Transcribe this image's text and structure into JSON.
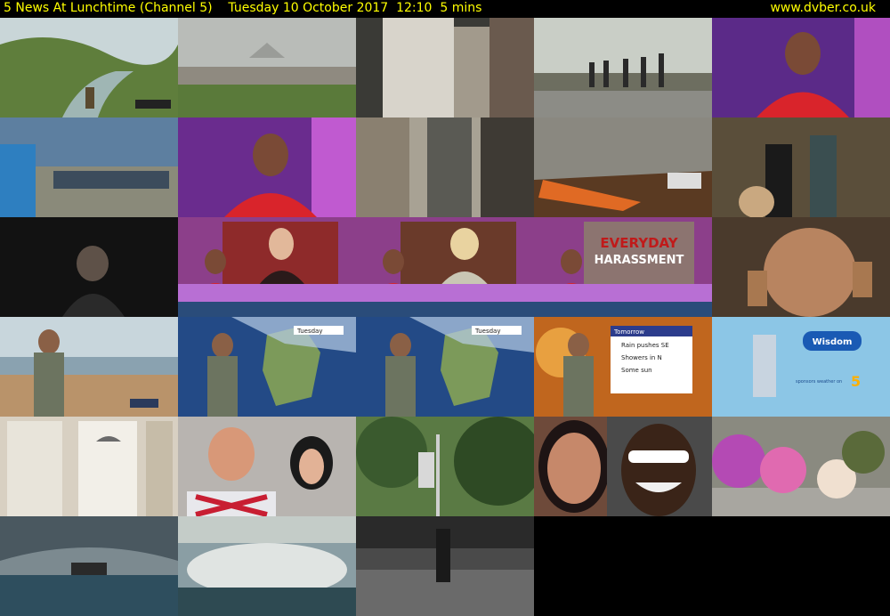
{
  "header": {
    "title": "5 News At Lunchtime (Channel 5)    Tuesday 10 October 2017  12:10  5 mins",
    "site": "www.dvber.co.uk"
  },
  "colors": {
    "header_text": "#ffff00",
    "background": "#000000"
  },
  "thumbnails": [
    {
      "id": 1,
      "bg": "#6f8a4c",
      "text": []
    },
    {
      "id": 2,
      "bg": "#8a8f86",
      "text": []
    },
    {
      "id": 3,
      "bg": "#b9b4ab",
      "text": []
    },
    {
      "id": 4,
      "bg": "#9aa28e",
      "text": []
    },
    {
      "id": 5,
      "bg": "#6a2c8e",
      "text": []
    },
    {
      "id": 6,
      "bg": "#4e6c86",
      "text": []
    },
    {
      "id": 7,
      "bg": "#7b2d9b",
      "text": []
    },
    {
      "id": 8,
      "bg": "#8c8577",
      "text": []
    },
    {
      "id": 9,
      "bg": "#7f7a72",
      "text": []
    },
    {
      "id": 10,
      "bg": "#50493a",
      "text": []
    },
    {
      "id": 11,
      "bg": "#151515",
      "text": []
    },
    {
      "id": 12,
      "bg": "#8c3f8a",
      "text": []
    },
    {
      "id": 13,
      "bg": "#8c3f8a",
      "text": []
    },
    {
      "id": 14,
      "bg": "#8c3f8a",
      "text": [
        "EVERYDAY",
        "HARASSMENT"
      ]
    },
    {
      "id": 15,
      "bg": "#6c4a36",
      "text": []
    },
    {
      "id": 16,
      "bg": "#b49876",
      "text": []
    },
    {
      "id": 17,
      "bg": "#234a86",
      "text": [
        "Tuesday"
      ]
    },
    {
      "id": 18,
      "bg": "#234a86",
      "text": [
        "Tuesday"
      ]
    },
    {
      "id": 19,
      "bg": "#c0661e",
      "text": [
        "Tomorrow",
        "Rain pushes SE",
        "Showers in N",
        "Some sun"
      ]
    },
    {
      "id": 20,
      "bg": "#8cc6e6",
      "text": [
        "Wisdom",
        "sponsors weather on",
        "5"
      ]
    },
    {
      "id": 21,
      "bg": "#cfc6b8",
      "text": []
    },
    {
      "id": 22,
      "bg": "#a09a96",
      "text": []
    },
    {
      "id": 23,
      "bg": "#3e5a2e",
      "text": []
    },
    {
      "id": 24,
      "bg": "#6e4a3a",
      "text": []
    },
    {
      "id": 25,
      "bg": "#b56bb2",
      "text": []
    },
    {
      "id": 26,
      "bg": "#5e6a72",
      "text": []
    },
    {
      "id": 27,
      "bg": "#7a8e94",
      "text": []
    },
    {
      "id": 28,
      "bg": "#4a4a4a",
      "text": []
    }
  ]
}
